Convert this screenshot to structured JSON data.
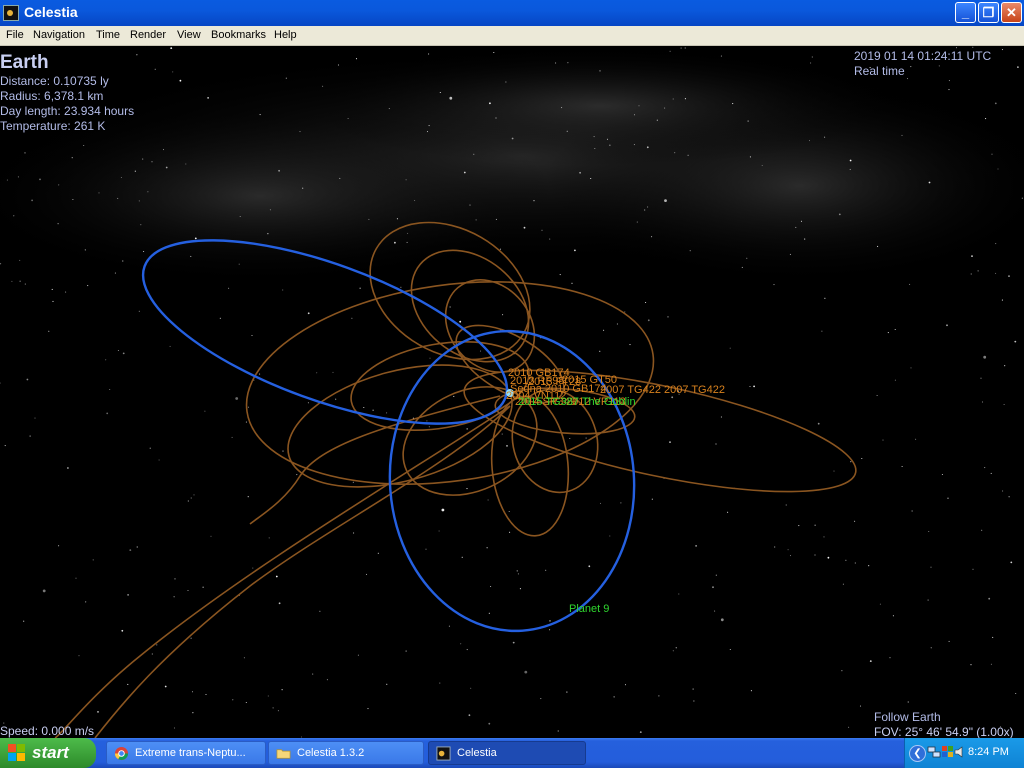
{
  "window": {
    "title": "Celestia",
    "minimize_label": "_",
    "maximize_label": "❐",
    "close_label": "✕"
  },
  "menu": {
    "items": [
      "File",
      "Navigation",
      "Time",
      "Render",
      "View",
      "Bookmarks",
      "Help"
    ]
  },
  "hud": {
    "object_name": "Earth",
    "distance": "Distance: 0.10735 ly",
    "radius": "Radius: 6,378.1 km",
    "day_length": "Day length: 23.934 hours",
    "temperature": "Temperature: 261 K",
    "datetime": "2019 01 14 01:24:11 UTC",
    "time_mode": "Real time",
    "speed": "Speed: 0.000 m/s",
    "follow": "Follow Earth",
    "fov": "FOV: 25° 46' 54.9\" (1.00x)"
  },
  "orbit_labels": {
    "l1": "2013 FT28",
    "l2": "2015 GT50",
    "l3": "2004 VN112",
    "l4": "2014 SR349",
    "l5": "2012 VP113",
    "l6": "2007 TG422 2007 TG422",
    "l7": "2015 TG387 The Goblin",
    "l8": "2010 GB174",
    "l9": "2013 RF98",
    "l10": "Sedna 2010 GB174",
    "l11": "Planet 9"
  },
  "colors": {
    "tno_orbit": "#8a5520",
    "planet_orbit": "#2560e0",
    "tno_label": "#d7801d",
    "planet_label": "#2fd62f",
    "hud_text": "#b3bce8"
  },
  "taskbar": {
    "start_label": "start",
    "tasks": [
      {
        "label": "Extreme trans-Neptu...",
        "icon": "chrome-icon"
      },
      {
        "label": "Celestia 1.3.2",
        "icon": "folder-icon"
      },
      {
        "label": "Celestia",
        "icon": "celestia-icon"
      }
    ],
    "tray_expand": "❮",
    "clock": "8:24 PM"
  }
}
